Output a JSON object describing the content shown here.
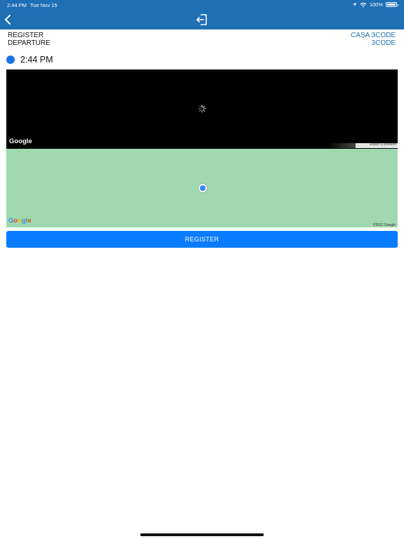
{
  "status_bar": {
    "time": "2:44 PM",
    "date": "Tue Nov 15",
    "battery": "100%"
  },
  "header": {
    "back_icon": "chevron-left-icon",
    "center_icon": "sign-out-icon"
  },
  "info": {
    "left_line1": "REGISTER",
    "left_line2": "DEPARTURE",
    "right_line1": "CASA 3CODE",
    "right_line2": "3CODE"
  },
  "event": {
    "time": "2:44 PM"
  },
  "maps": {
    "top_logo": "Google",
    "report_link": "Report a problem",
    "bottom_logo": "Google",
    "copyright": "©2022 Google"
  },
  "actions": {
    "register_label": "REGISTER"
  },
  "colors": {
    "header": "#1f6fb5",
    "accent": "#0a7cff",
    "map_green": "#a0d9b0",
    "link": "#1f6fb5"
  }
}
